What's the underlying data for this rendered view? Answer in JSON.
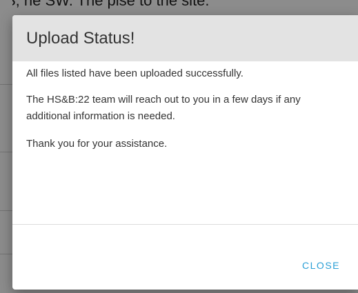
{
  "background": {
    "partial_text": "S, ne SW. The plse to the site."
  },
  "modal": {
    "title": "Upload Status!",
    "paragraphs": [
      "All files listed have been uploaded successfully.",
      "The HS&B:22 team will reach out to you in a few days if any additional information is needed.",
      "Thank you for your assistance."
    ],
    "close_label": "CLOSE"
  },
  "colors": {
    "header_bg": "#e3e3e3",
    "accent": "#2a9fd6",
    "overlay": "rgba(0,0,0,0.45)"
  }
}
